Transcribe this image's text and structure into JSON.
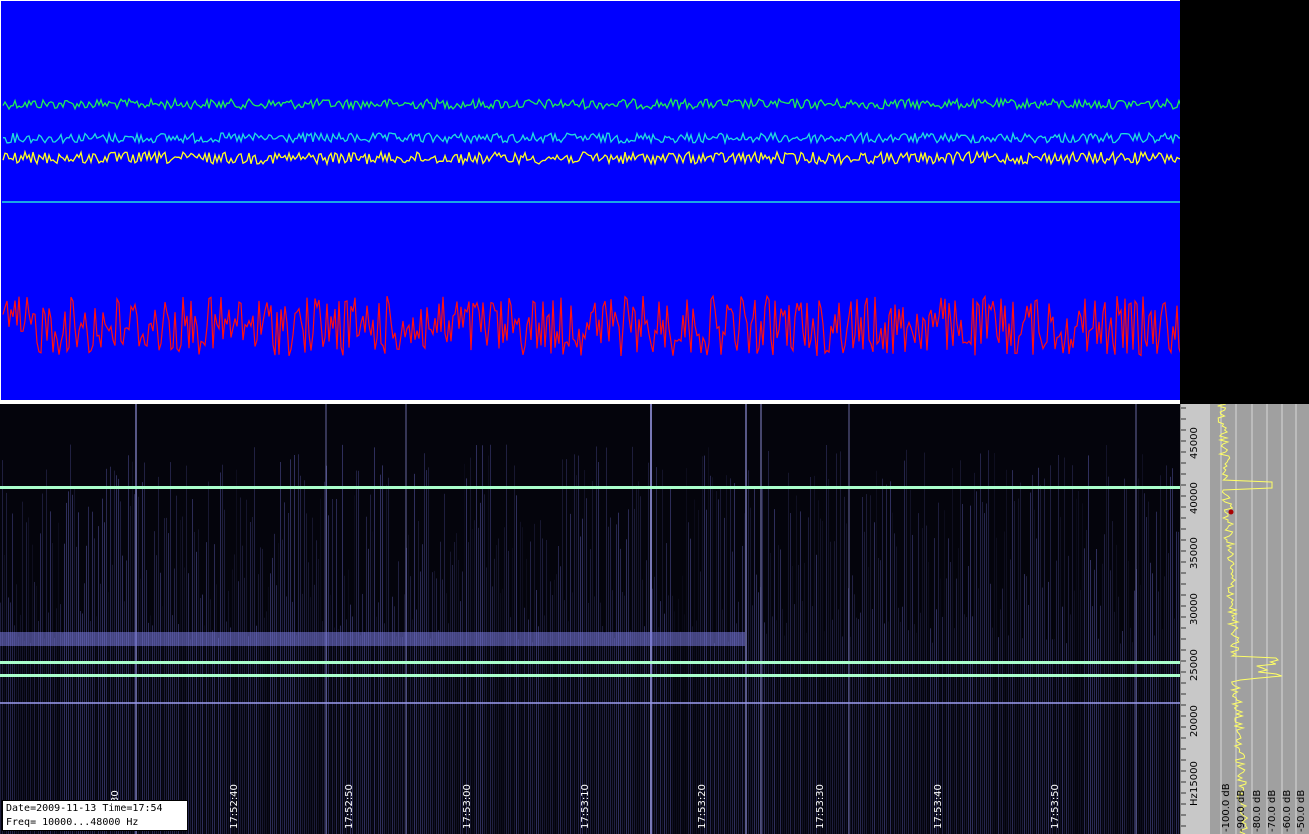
{
  "info": {
    "date_time": "Date=2009-11-13 Time=17:54",
    "freq_range": "Freq= 10000...48000 Hz"
  },
  "time_axis": {
    "labels": [
      "30",
      "17:52:40",
      "17:52:50",
      "17:53:00",
      "17:53:10",
      "17:53:20",
      "17:53:30",
      "17:53:40",
      "17:53:50"
    ]
  },
  "freq_axis": {
    "labels": [
      "45000",
      "40000",
      "35000",
      "30000",
      "25000",
      "20000",
      "15000",
      "Hz"
    ]
  },
  "spectrum_axis": {
    "labels": [
      "-100.0 dB",
      "-90.0 dB",
      "-80.0 dB",
      "-70.0 dB",
      "-60.0 dB",
      "-50.0 dB"
    ]
  },
  "traces": [
    {
      "color": "#22ee55",
      "name": "green-trace"
    },
    {
      "color": "#22dddd",
      "name": "cyan-trace"
    },
    {
      "color": "#ffff22",
      "name": "yellow-trace"
    },
    {
      "color": "#22dddd",
      "name": "flat-cyan-line"
    },
    {
      "color": "#ff1010",
      "name": "red-trace"
    }
  ],
  "colors": {
    "wave_background": "#0000ff",
    "spectrogram_line": "#aaffcc",
    "spectrum_trace": "#ffff66"
  }
}
